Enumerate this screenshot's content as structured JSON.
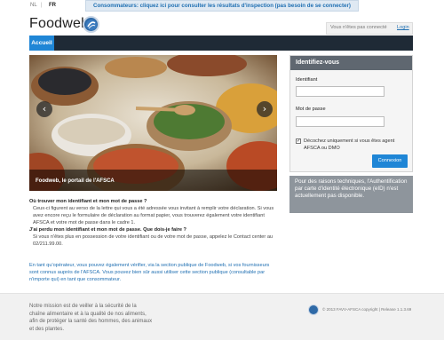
{
  "languages": {
    "nl": "NL",
    "separator": "|",
    "fr": "FR"
  },
  "consumer_banner": "Consommateurs: cliquez ici pour consulter les résultats d'inspection (pas besoin de se connecter)",
  "brand": {
    "name": "Foodweb",
    "logo_icon": "afsca-logo-icon"
  },
  "header": {
    "not_connected": "Vous n'êtes pas connecté",
    "login": "Login"
  },
  "nav": {
    "tabs": [
      {
        "label": "Accueil",
        "active": true
      }
    ]
  },
  "carousel": {
    "caption": "Foodweb, le portail de l'AFSCA",
    "prev": "‹",
    "next": "›"
  },
  "login_panel": {
    "title": "Identifiez-vous",
    "identifier_label": "Identifiant",
    "identifier_value": "",
    "password_label": "Mot de passe",
    "password_value": "",
    "checkbox_label": "Décochez uniquement si vous êtes agent AFSCA ou DMO",
    "checkbox_checked": true,
    "checkbox_mark": "✓",
    "connect_button": "Connexion"
  },
  "info_box": "Pour des raisons techniques, l'Authentification par carte d'identité électronique (eID) n'est actuellement pas disponible.",
  "content": {
    "q1": "Où trouver mon identifiant et mon mot de passe ?",
    "a1": "Ceux-ci figurent au verso de la lettre qui vous a été adressée vous invitant à remplir votre déclaration. Si vous avez encore reçu le formulaire de déclaration au format papier, vous trouverez également votre identifiant AFSCA et votre mot de passe dans le cadre 1.",
    "q2": "J'ai perdu mon identifiant et mon mot de passe. Que dois-je faire ?",
    "a2": "Si vous n'êtes plus en possession de votre identifiant ou de votre mot de passe, appelez le Contact center au 02/211.99.00.",
    "operator_text": "En tant qu'opérateur, vous pouvez également vérifier, via la section publique de Foodweb, si vos fournisseurs sont connus auprès de l'AFSCA. Vous pouvez bien sûr aussi utiliser cette section publique (consultable par n'importe qui) en tant que consommateur."
  },
  "footer": {
    "mission": "Notre mission est de veiller à la sécurité de la chaîne alimentaire et à la qualité de nos aliments, afin de protéger la santé des hommes, des animaux et des plantes.",
    "copyright": "© 2013 FAVV-AFSCA copyright | Release 1.1.3.69"
  },
  "colors": {
    "primary": "#1f86d6",
    "nav_dark": "#1f2a36",
    "panel_head": "#5f6770",
    "info_box": "#8e959c",
    "link": "#1f6fb2"
  }
}
